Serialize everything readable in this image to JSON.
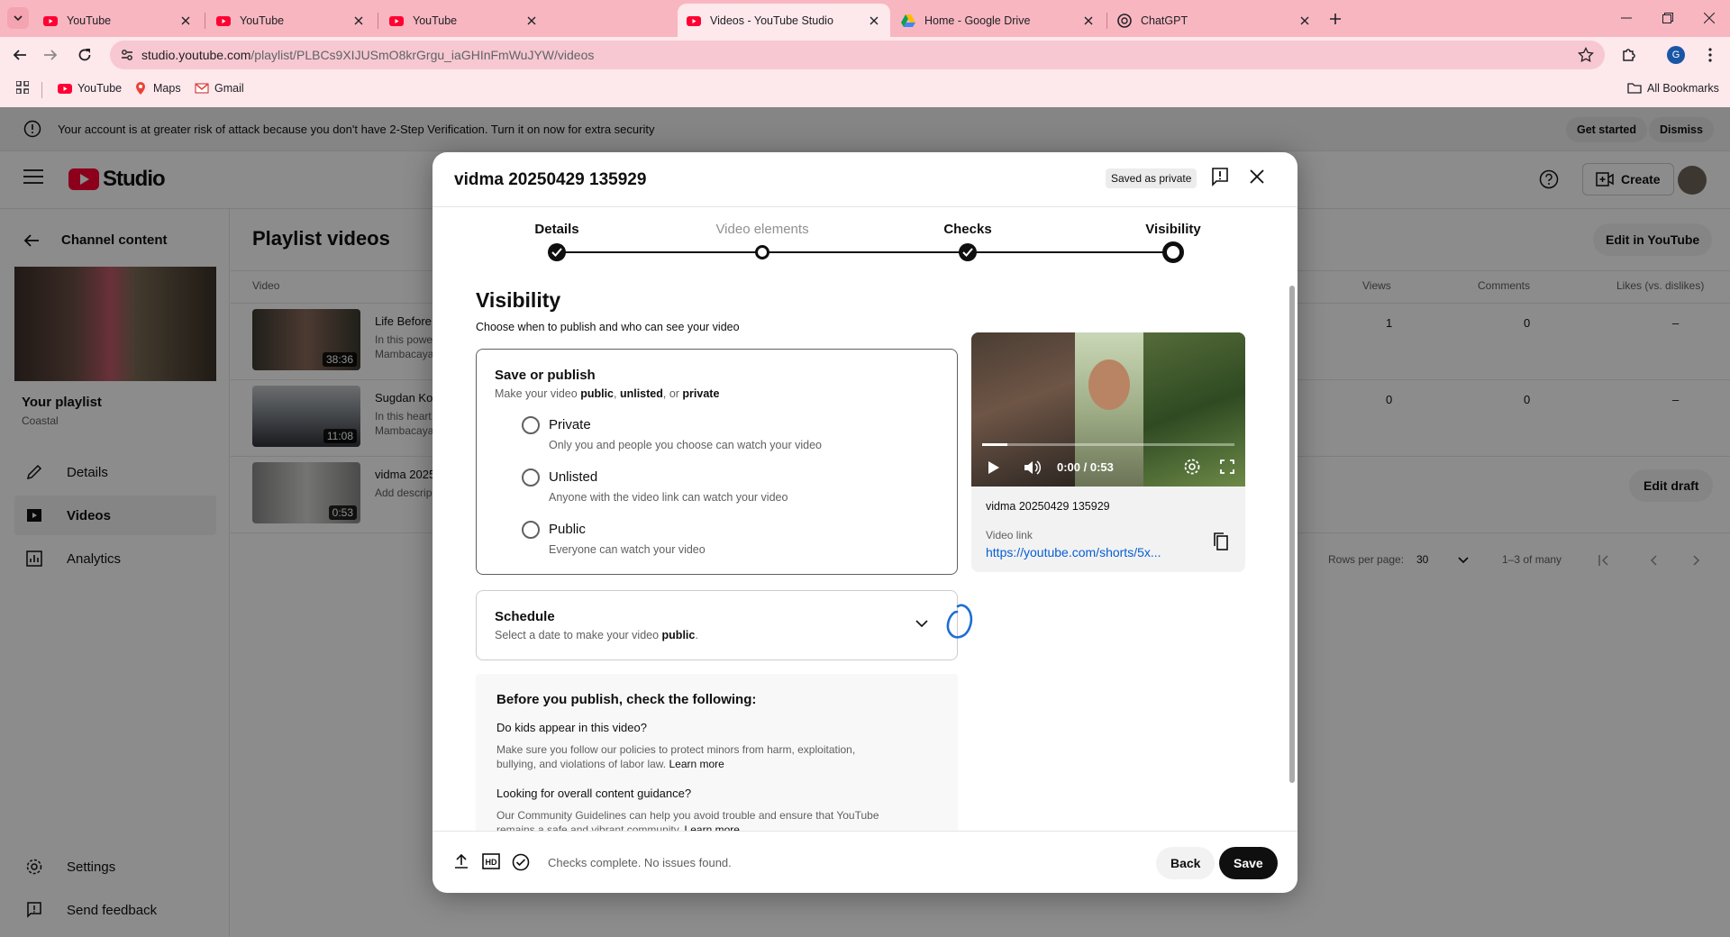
{
  "browser": {
    "tabs": [
      {
        "title": "YouTube",
        "icon": "youtube-icon"
      },
      {
        "title": "YouTube",
        "icon": "youtube-icon"
      },
      {
        "title": "YouTube",
        "icon": "youtube-icon"
      },
      {
        "title": "Videos - YouTube Studio",
        "icon": "youtube-icon",
        "active": true
      },
      {
        "title": "Home - Google Drive",
        "icon": "google-drive-icon"
      },
      {
        "title": "ChatGPT",
        "icon": "chatgpt-icon"
      }
    ],
    "url_host": "studio.youtube.com",
    "url_path": "/playlist/PLBCs9XIJUSmO8krGrgu_iaGHInFmWuJYW/videos",
    "profile_initial": "G",
    "bookmarks": [
      {
        "label": "YouTube",
        "icon": "youtube-icon"
      },
      {
        "label": "Maps",
        "icon": "maps-icon"
      },
      {
        "label": "Gmail",
        "icon": "gmail-icon"
      }
    ],
    "all_bookmarks": "All Bookmarks"
  },
  "alert": {
    "text": "Your account is at greater risk of attack because you don't have 2-Step Verification. Turn it on now for extra security",
    "get_started": "Get started",
    "dismiss": "Dismiss"
  },
  "studio": {
    "logo_text": "Studio",
    "create": "Create"
  },
  "sidebar": {
    "back_label": "Channel content",
    "playlist_title": "Your playlist",
    "playlist_sub": "Coastal",
    "items": [
      {
        "label": "Details",
        "icon": "pencil-icon"
      },
      {
        "label": "Videos",
        "icon": "video-icon"
      },
      {
        "label": "Analytics",
        "icon": "analytics-icon"
      }
    ],
    "bottom": [
      {
        "label": "Settings",
        "icon": "gear-icon"
      },
      {
        "label": "Send feedback",
        "icon": "feedback-icon"
      }
    ]
  },
  "main": {
    "title": "Playlist videos",
    "edit_in_youtube": "Edit in YouTube",
    "columns": {
      "video": "Video",
      "views": "Views",
      "comments": "Comments",
      "likes": "Likes (vs. dislikes)"
    },
    "rows": [
      {
        "title": "Life Before",
        "desc": "In this powe Mambacaya",
        "duration": "38:36",
        "views": "1",
        "comments": "0",
        "likes": "–"
      },
      {
        "title": "Sugdan Ko",
        "desc": "In this heart Mambacaya",
        "duration": "11:08",
        "views": "0",
        "comments": "0",
        "likes": "–"
      },
      {
        "title": "vidma 2025",
        "desc": "Add descrip",
        "duration": "0:53",
        "action": "Edit draft"
      }
    ],
    "rows_per_page_label": "Rows per page:",
    "rows_per_page": "30",
    "range": "1–3 of many"
  },
  "modal": {
    "title": "vidma 20250429 135929",
    "saved_badge": "Saved as private",
    "steps": [
      "Details",
      "Video elements",
      "Checks",
      "Visibility"
    ],
    "heading": "Visibility",
    "subheading": "Choose when to publish and who can see your video",
    "save_publish": {
      "title": "Save or publish",
      "desc_pre": "Make your video ",
      "desc_public": "public",
      "desc_sep1": ", ",
      "desc_unlisted": "unlisted",
      "desc_sep2": ", or ",
      "desc_private": "private",
      "options": [
        {
          "label": "Private",
          "desc": "Only you and people you choose can watch your video"
        },
        {
          "label": "Unlisted",
          "desc": "Anyone with the video link can watch your video"
        },
        {
          "label": "Public",
          "desc": "Everyone can watch your video"
        }
      ]
    },
    "schedule": {
      "title": "Schedule",
      "desc_pre": "Select a date to make your video ",
      "desc_bold": "public",
      "desc_post": "."
    },
    "checks": {
      "title": "Before you publish, check the following:",
      "q1": "Do kids appear in this video?",
      "a1": "Make sure you follow our policies to protect minors from harm, exploitation, bullying, and violations of labor law.",
      "q2": "Looking for overall content guidance?",
      "a2": "Our Community Guidelines can help you avoid trouble and ensure that YouTube remains a safe and vibrant community.",
      "learn_more": "Learn more"
    },
    "preview": {
      "time": "0:00 / 0:53",
      "name": "vidma 20250429 135929",
      "link_label": "Video link",
      "link": "https://youtube.com/shorts/5x..."
    },
    "footer": {
      "status": "Checks complete. No issues found.",
      "back": "Back",
      "save": "Save"
    }
  }
}
